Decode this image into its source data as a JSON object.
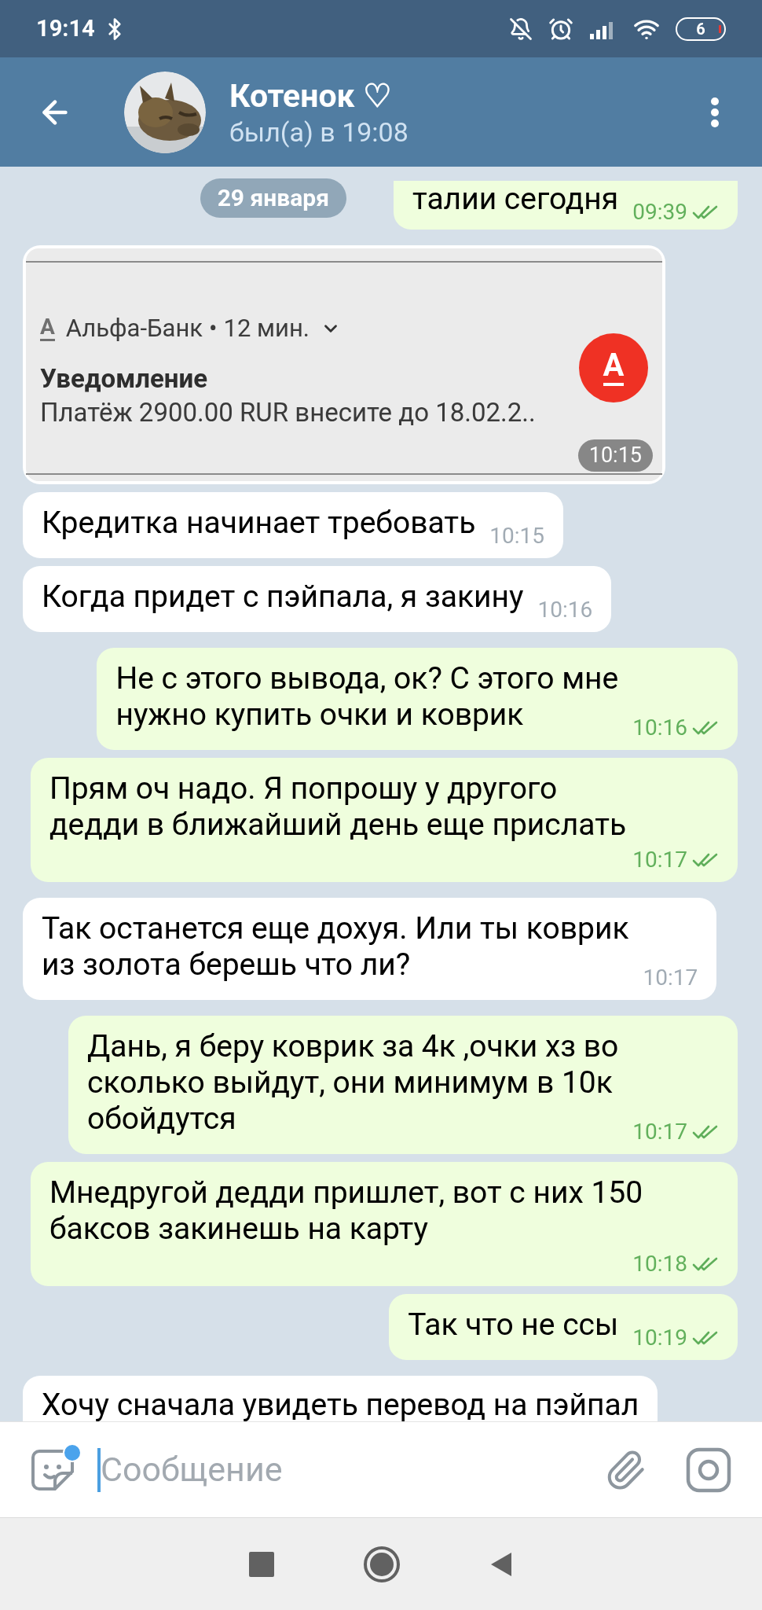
{
  "status_bar": {
    "time": "19:14",
    "battery": "6"
  },
  "header": {
    "title": "Котенок ♡",
    "subtitle": "был(а) в 19:08"
  },
  "date_chip": "29 января",
  "messages": [
    {
      "kind": "text",
      "outgoing": true,
      "lines": [
        "талии сегодня"
      ],
      "time": "09:39",
      "read": true
    },
    {
      "kind": "notification_screenshot",
      "outgoing": false,
      "app_letter": "А",
      "app": "Альфа-Банк",
      "separator": "•",
      "age": "12 мин.",
      "title": "Уведомление",
      "body": "Платёж 2900.00 RUR внесите до 18.02.2..",
      "logo_letter": "А",
      "time": "10:15"
    },
    {
      "kind": "text",
      "outgoing": false,
      "lines": [
        "Кредитка начинает требовать"
      ],
      "time": "10:15"
    },
    {
      "kind": "text",
      "outgoing": false,
      "lines": [
        "Когда придет с пэйпала, я закину"
      ],
      "time": "10:16"
    },
    {
      "kind": "text",
      "outgoing": true,
      "lines": [
        "Не с этого вывода, ок? С этого мне",
        "нужно купить очки и коврик"
      ],
      "time": "10:16",
      "read": true
    },
    {
      "kind": "text",
      "outgoing": true,
      "lines": [
        "Прям оч надо. Я попрошу у другого",
        "дедди в ближайший день еще прислать"
      ],
      "time": "10:17",
      "read": true
    },
    {
      "kind": "text",
      "outgoing": false,
      "lines": [
        "Так останется еще дохуя. Или ты коврик",
        "из золота берешь что ли?"
      ],
      "time": "10:17"
    },
    {
      "kind": "text",
      "outgoing": true,
      "lines": [
        "Дань, я беру коврик за 4к ,очки хз во",
        "сколько выйдут, они минимум в 10к",
        "обойдутся"
      ],
      "time": "10:17",
      "read": true
    },
    {
      "kind": "text",
      "outgoing": true,
      "lines": [
        "Мнедругой дедди пришлет, вот с них 150",
        "баксов закинешь на карту"
      ],
      "time": "10:18",
      "read": true
    },
    {
      "kind": "text",
      "outgoing": true,
      "lines": [
        "Так что не ссы"
      ],
      "time": "10:19",
      "read": true
    },
    {
      "kind": "partial",
      "outgoing": false,
      "lines": [
        "Хочу сначала увидеть перевод на пэйпал"
      ]
    }
  ],
  "composer": {
    "placeholder": "Сообщение"
  }
}
